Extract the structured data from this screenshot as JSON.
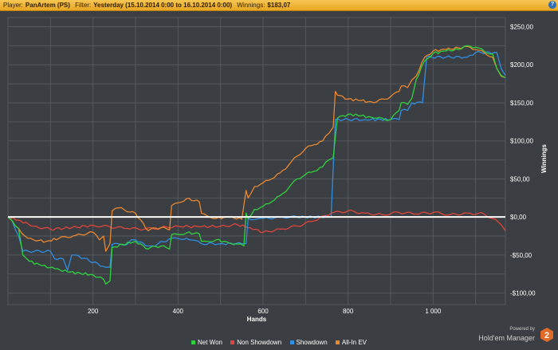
{
  "header": {
    "player_label": "Player:",
    "player_value": "PanArtem (PS)",
    "filter_label": "Filter:",
    "filter_value": "Yesterday (15.10.2014 0:00 to 16.10.2014 0:00)",
    "winnings_label": "Winnings:",
    "winnings_value": "$183,07",
    "help_icon": "?"
  },
  "colors": {
    "background": "#3b3e42",
    "grid": "#55595e",
    "zero_line": "#ffffff",
    "header": "#f0b338"
  },
  "chart_data": {
    "type": "line",
    "xlabel": "Hands",
    "ylabel": "Winnings",
    "xlim": [
      0,
      1170
    ],
    "ylim": [
      -115,
      262
    ],
    "x_ticks": [
      200,
      400,
      600,
      800,
      1000
    ],
    "x_tick_labels": [
      "200",
      "400",
      "600",
      "800",
      "1 000"
    ],
    "y_ticks": [
      250,
      200,
      150,
      100,
      50,
      0,
      -50,
      -100
    ],
    "y_tick_labels": [
      "$250,00",
      "$200,00",
      "$150,00",
      "$100,00",
      "$50,00",
      "$0,00",
      "-$50,00",
      "-$100,00"
    ],
    "grid": true,
    "legend_position": "bottom",
    "series": [
      {
        "name": "Net Won",
        "color": "#2fd33f",
        "x": [
          0,
          10,
          25,
          35,
          50,
          80,
          110,
          140,
          170,
          200,
          225,
          230,
          240,
          245,
          270,
          300,
          330,
          335,
          360,
          380,
          385,
          420,
          450,
          455,
          490,
          520,
          555,
          560,
          565,
          580,
          600,
          620,
          640,
          660,
          680,
          700,
          720,
          740,
          755,
          765,
          775,
          800,
          830,
          860,
          900,
          920,
          925,
          940,
          950,
          960,
          980,
          1000,
          1030,
          1060,
          1080,
          1100,
          1120,
          1140,
          1150,
          1160,
          1170
        ],
        "y": [
          0,
          -5,
          -15,
          -50,
          -58,
          -64,
          -68,
          -72,
          -74,
          -76,
          -82,
          -88,
          -84,
          -40,
          -36,
          -32,
          -42,
          -40,
          -38,
          -42,
          -23,
          -21,
          -22,
          -32,
          -30,
          -34,
          -38,
          5,
          -2,
          10,
          14,
          20,
          28,
          38,
          50,
          56,
          60,
          66,
          75,
          78,
          130,
          135,
          133,
          130,
          128,
          140,
          150,
          148,
          156,
          180,
          205,
          215,
          218,
          220,
          225,
          223,
          218,
          214,
          195,
          186,
          183
        ]
      },
      {
        "name": "Non Showdown",
        "color": "#e0463c",
        "x": [
          0,
          30,
          60,
          100,
          150,
          200,
          240,
          280,
          320,
          360,
          400,
          450,
          500,
          540,
          570,
          600,
          640,
          680,
          720,
          760,
          800,
          840,
          880,
          920,
          960,
          1000,
          1040,
          1080,
          1120,
          1140,
          1160,
          1170
        ],
        "y": [
          0,
          -5,
          -12,
          -16,
          -14,
          -11,
          -13,
          -15,
          -16,
          -14,
          -12,
          -13,
          -12,
          -10,
          -14,
          -20,
          -16,
          -12,
          -5,
          5,
          8,
          5,
          3,
          6,
          4,
          6,
          3,
          5,
          4,
          -2,
          -10,
          -18
        ]
      },
      {
        "name": "Showdown",
        "color": "#2f8fe3",
        "x": [
          0,
          10,
          25,
          35,
          100,
          110,
          130,
          140,
          150,
          160,
          230,
          240,
          245,
          280,
          290,
          300,
          330,
          340,
          385,
          420,
          455,
          500,
          550,
          560,
          565,
          600,
          640,
          680,
          760,
          770,
          840,
          900,
          920,
          925,
          940,
          950,
          975,
          985,
          1080,
          1100,
          1150,
          1160,
          1170
        ],
        "y": [
          0,
          -5,
          -25,
          -45,
          -45,
          -55,
          -55,
          -70,
          -50,
          -50,
          -66,
          -66,
          -36,
          -36,
          -30,
          -30,
          -38,
          -38,
          -28,
          -28,
          -35,
          -35,
          -35,
          -35,
          -2,
          -2,
          0,
          0,
          0,
          128,
          128,
          128,
          128,
          140,
          140,
          150,
          150,
          210,
          210,
          216,
          216,
          195,
          186
        ]
      },
      {
        "name": "All-In EV",
        "color": "#ea8830",
        "x": [
          0,
          10,
          25,
          40,
          60,
          90,
          120,
          160,
          200,
          215,
          225,
          230,
          240,
          245,
          260,
          300,
          330,
          335,
          360,
          380,
          385,
          420,
          450,
          455,
          490,
          520,
          550,
          560,
          565,
          580,
          600,
          620,
          640,
          660,
          680,
          700,
          720,
          740,
          755,
          765,
          770,
          775,
          800,
          830,
          860,
          900,
          920,
          925,
          940,
          950,
          960,
          980,
          1000,
          1030,
          1060,
          1080,
          1100,
          1120,
          1140,
          1150,
          1160,
          1170
        ],
        "y": [
          0,
          -5,
          -15,
          -25,
          -30,
          -32,
          -28,
          -24,
          -20,
          -30,
          -25,
          -45,
          -35,
          8,
          12,
          5,
          -18,
          -16,
          -14,
          -17,
          15,
          24,
          20,
          5,
          -2,
          0,
          -3,
          35,
          25,
          40,
          45,
          50,
          58,
          68,
          80,
          90,
          95,
          100,
          110,
          118,
          165,
          160,
          155,
          153,
          150,
          158,
          165,
          172,
          170,
          180,
          185,
          210,
          218,
          220,
          222,
          224,
          220,
          216,
          210,
          195,
          185,
          183
        ]
      }
    ]
  },
  "legend": {
    "items": [
      "Net Won",
      "Non Showdown",
      "Showdown",
      "All-In EV"
    ]
  },
  "branding": {
    "powered_by": "Powered by",
    "product": "Hold'em Manager",
    "badge": "2"
  }
}
